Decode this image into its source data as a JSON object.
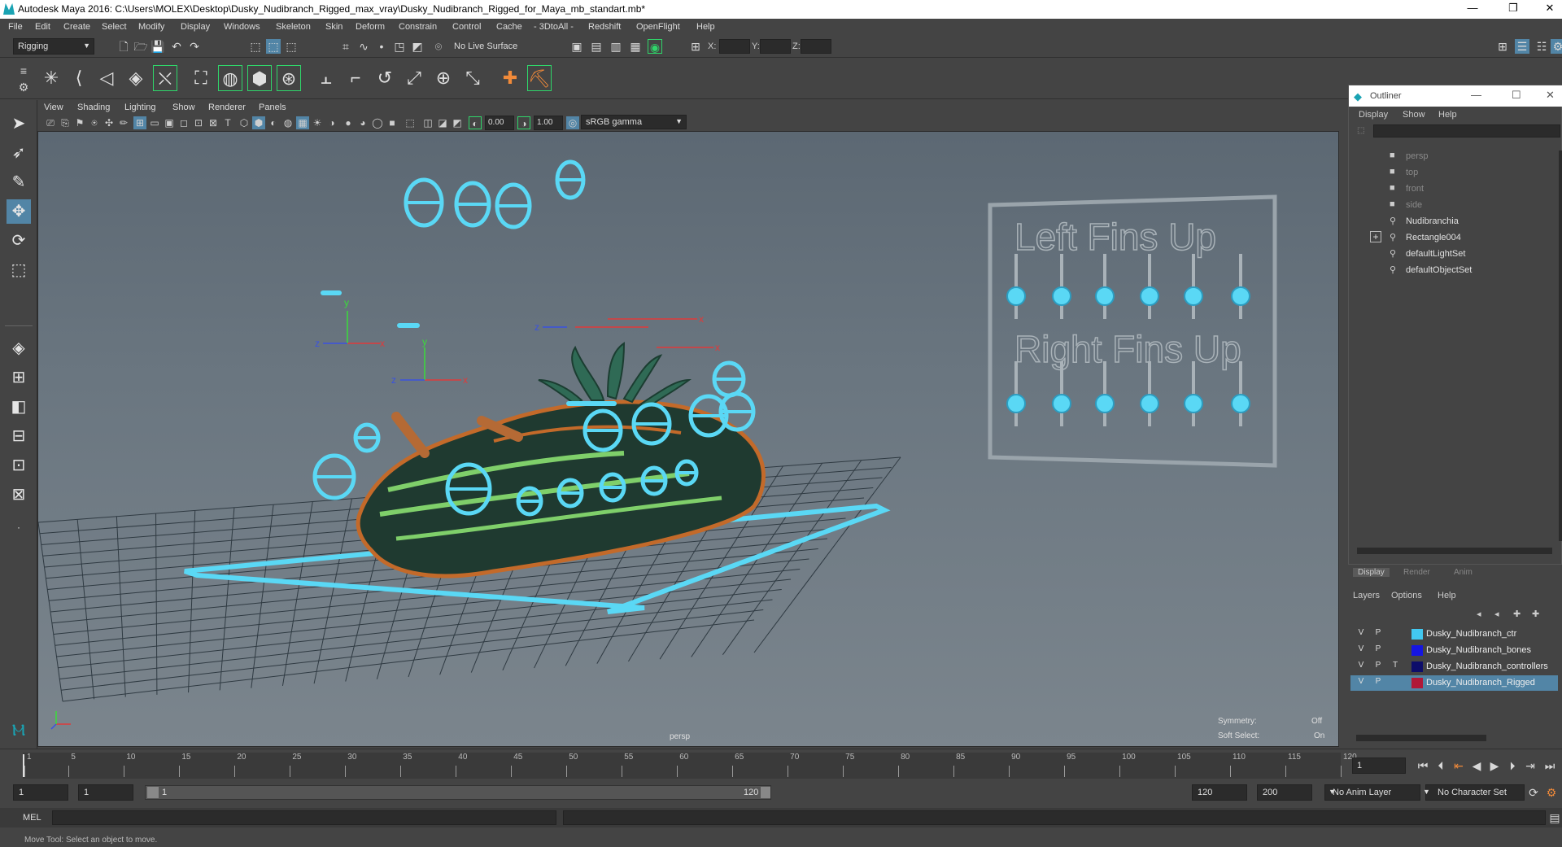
{
  "window": {
    "title": "Autodesk Maya 2016: C:\\Users\\MOLEX\\Desktop\\Dusky_Nudibranch_Rigged_max_vray\\Dusky_Nudibranch_Rigged_for_Maya_mb_standart.mb*",
    "controls": [
      "—",
      "❐",
      "✕"
    ]
  },
  "menubar": [
    "File",
    "Edit",
    "Create",
    "Select",
    "Modify",
    "Display",
    "Windows",
    "Skeleton",
    "Skin",
    "Deform",
    "Constrain",
    "Control",
    "Cache",
    "- 3DtoAll -",
    "Redshift",
    "OpenFlight",
    "Help"
  ],
  "statusline": {
    "menuset": "Rigging",
    "live_surface": "No Live Surface",
    "x_label": "X:",
    "y_label": "Y:",
    "z_label": "Z:"
  },
  "viewport": {
    "menu": [
      "View",
      "Shading",
      "Lighting",
      "Show",
      "Renderer",
      "Panels"
    ],
    "exposure": "0.00",
    "gamma": "1.00",
    "color_space": "sRGB gamma",
    "camera_label": "persp",
    "hud": {
      "symmetry_label": "Symmetry:",
      "symmetry_value": "Off",
      "soft_select_label": "Soft Select:",
      "soft_select_value": "On"
    },
    "board": {
      "top_text": "Left Fins Up",
      "bottom_text": "Right Fins Up"
    },
    "axis": {
      "x": "x",
      "y": "y",
      "z": "z"
    },
    "colors": {
      "controller": "#5ad8f5",
      "grid": "#2f3a42",
      "slug_dark": "#1f3a30",
      "slug_stripe": "#7fcf6a",
      "slug_rim": "#c36a2a"
    }
  },
  "outliner": {
    "title": "Outliner",
    "menu": [
      "Display",
      "Show",
      "Help"
    ],
    "items": [
      {
        "label": "persp",
        "dim": true
      },
      {
        "label": "top",
        "dim": true
      },
      {
        "label": "front",
        "dim": true
      },
      {
        "label": "side",
        "dim": true
      },
      {
        "label": "Nudibranchia",
        "dim": false
      },
      {
        "label": "Rectangle004",
        "dim": false,
        "expand": "+"
      },
      {
        "label": "defaultLightSet",
        "dim": false
      },
      {
        "label": "defaultObjectSet",
        "dim": false
      }
    ]
  },
  "layer_editor": {
    "tabs": [
      "Display",
      "Render",
      "Anim"
    ],
    "menu": [
      "Layers",
      "Options",
      "Help"
    ],
    "layers": [
      {
        "v": "V",
        "p": "P",
        "t": "",
        "name": "Dusky_Nudibranch_ctr",
        "color": "#42c8f0",
        "selected": false
      },
      {
        "v": "V",
        "p": "P",
        "t": "",
        "name": "Dusky_Nudibranch_bones",
        "color": "#1515e0",
        "selected": false
      },
      {
        "v": "V",
        "p": "P",
        "t": "T",
        "name": "Dusky_Nudibranch_controllers",
        "color": "#0d0d6a",
        "selected": false
      },
      {
        "v": "V",
        "p": "P",
        "t": "",
        "name": "Dusky_Nudibranch_Rigged",
        "color": "#b01838",
        "selected": true
      }
    ]
  },
  "timeline": {
    "ticks": [
      "1",
      "5",
      "10",
      "15",
      "20",
      "25",
      "30",
      "35",
      "40",
      "45",
      "50",
      "55",
      "60",
      "65",
      "70",
      "75",
      "80",
      "85",
      "90",
      "95",
      "100",
      "105",
      "110",
      "115",
      "120"
    ],
    "current_frame": "1"
  },
  "range": {
    "start": "1",
    "playback_start": "1",
    "slider_start": "1",
    "slider_end": "120",
    "playback_end": "120",
    "end": "200",
    "anim_layer": "No Anim Layer",
    "character_set": "No Character Set"
  },
  "cmdline": {
    "label": "MEL"
  },
  "helpline": {
    "text": "Move Tool: Select an object to move."
  }
}
